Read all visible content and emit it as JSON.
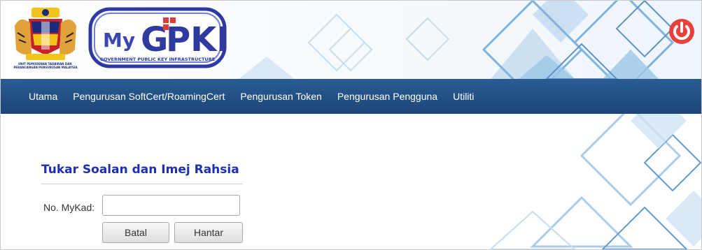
{
  "header": {
    "coat_of_arms_text": "UNIT PEMODENAN TADBIRAN DAN PERANCANGAN PENGURUSAN MALAYSIA",
    "logo_text": "MyGPKI",
    "logo_subtext": "GOVERNMENT PUBLIC KEY INFRASTRUCTURE",
    "power_icon": "power-icon"
  },
  "nav": {
    "items": [
      {
        "label": "Utama"
      },
      {
        "label": "Pengurusan SoftCert/RoamingCert"
      },
      {
        "label": "Pengurusan Token"
      },
      {
        "label": "Pengurusan Pengguna"
      },
      {
        "label": "Utiliti"
      }
    ]
  },
  "form": {
    "title": "Tukar Soalan dan Imej Rahsia",
    "mykad_label": "No. MyKad:",
    "mykad_value": "",
    "cancel_label": "Batal",
    "submit_label": "Hantar"
  },
  "colors": {
    "nav_bg": "#1d4678",
    "title": "#1c2fb3",
    "power": "#e8403a",
    "accent_light": "#9cc8e8"
  }
}
